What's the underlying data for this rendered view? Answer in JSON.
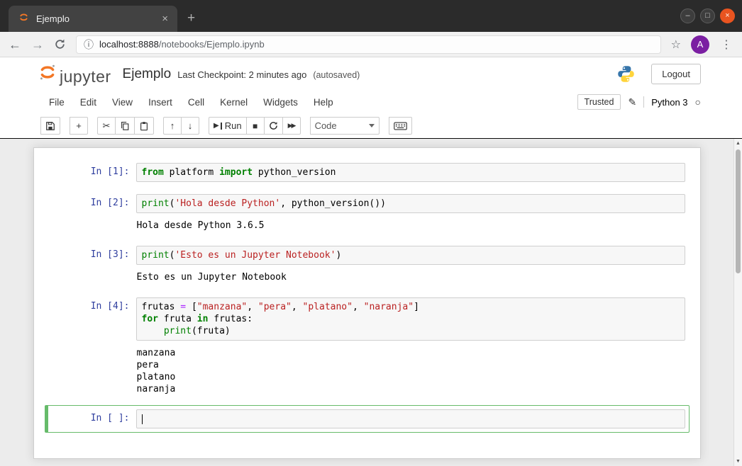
{
  "window": {
    "tab_title": "Ejemplo"
  },
  "icons": {
    "close": "×",
    "new_tab": "+",
    "minimize": "–",
    "maximize": "□",
    "back": "←",
    "forward": "→",
    "info": "ⓘ",
    "star": "☆",
    "kebab": "⋮",
    "cut": "✂",
    "up": "↑",
    "down": "↓",
    "play": "▶",
    "stop": "■",
    "fast_forward": "▶▶",
    "add": "+",
    "pencil": "✎",
    "kernel_idle": "○",
    "scroll_up": "▲",
    "scroll_down": "▼"
  },
  "browser": {
    "url_host": "localhost:8888",
    "url_path": "/notebooks/Ejemplo.ipynb",
    "avatar_letter": "A"
  },
  "header": {
    "logo_text": "jupyter",
    "title": "Ejemplo",
    "checkpoint": "Last Checkpoint: 2 minutes ago",
    "autosaved": "(autosaved)",
    "logout_label": "Logout"
  },
  "menu": {
    "items": [
      "File",
      "Edit",
      "View",
      "Insert",
      "Cell",
      "Kernel",
      "Widgets",
      "Help"
    ],
    "trusted_label": "Trusted",
    "kernel_name": "Python 3"
  },
  "toolbar": {
    "run_label": "Run",
    "cell_type": "Code"
  },
  "colors": {
    "jupyter_orange": "#F37726",
    "prompt_blue": "#303F9F",
    "keyword_green": "#008000",
    "string_red": "#BA2121",
    "operator_purple": "#AA22FF",
    "selected_cell_green": "#66BB6A",
    "avatar_purple": "#7B1FA2",
    "ubuntu_close_orange": "#E95420"
  },
  "notebook": {
    "cells": [
      {
        "prompt": "In [1]:",
        "lines": [
          [
            {
              "t": "from",
              "c": "kw"
            },
            {
              "t": " platform ",
              "c": ""
            },
            {
              "t": "import",
              "c": "kw"
            },
            {
              "t": " python_version",
              "c": ""
            }
          ]
        ],
        "outputs": []
      },
      {
        "prompt": "In [2]:",
        "lines": [
          [
            {
              "t": "print",
              "c": "fn"
            },
            {
              "t": "(",
              "c": ""
            },
            {
              "t": "'Hola desde Python'",
              "c": "str"
            },
            {
              "t": ", python_version())",
              "c": ""
            }
          ]
        ],
        "outputs": [
          "Hola desde Python 3.6.5"
        ]
      },
      {
        "prompt": "In [3]:",
        "lines": [
          [
            {
              "t": "print",
              "c": "fn"
            },
            {
              "t": "(",
              "c": ""
            },
            {
              "t": "'Esto es un Jupyter Notebook'",
              "c": "str"
            },
            {
              "t": ")",
              "c": ""
            }
          ]
        ],
        "outputs": [
          "Esto es un Jupyter Notebook"
        ]
      },
      {
        "prompt": "In [4]:",
        "lines": [
          [
            {
              "t": "frutas ",
              "c": ""
            },
            {
              "t": "=",
              "c": "op"
            },
            {
              "t": " [",
              "c": ""
            },
            {
              "t": "\"manzana\"",
              "c": "str"
            },
            {
              "t": ", ",
              "c": ""
            },
            {
              "t": "\"pera\"",
              "c": "str"
            },
            {
              "t": ", ",
              "c": ""
            },
            {
              "t": "\"platano\"",
              "c": "str"
            },
            {
              "t": ", ",
              "c": ""
            },
            {
              "t": "\"naranja\"",
              "c": "str"
            },
            {
              "t": "]",
              "c": ""
            }
          ],
          [
            {
              "t": "for",
              "c": "kw"
            },
            {
              "t": " fruta ",
              "c": ""
            },
            {
              "t": "in",
              "c": "kw"
            },
            {
              "t": " frutas:",
              "c": ""
            }
          ],
          [
            {
              "t": "    ",
              "c": ""
            },
            {
              "t": "print",
              "c": "fn"
            },
            {
              "t": "(fruta)",
              "c": ""
            }
          ]
        ],
        "outputs": [
          "manzana",
          "pera",
          "platano",
          "naranja"
        ]
      },
      {
        "prompt": "In [ ]:",
        "lines": [],
        "outputs": [],
        "selected": true
      }
    ]
  }
}
